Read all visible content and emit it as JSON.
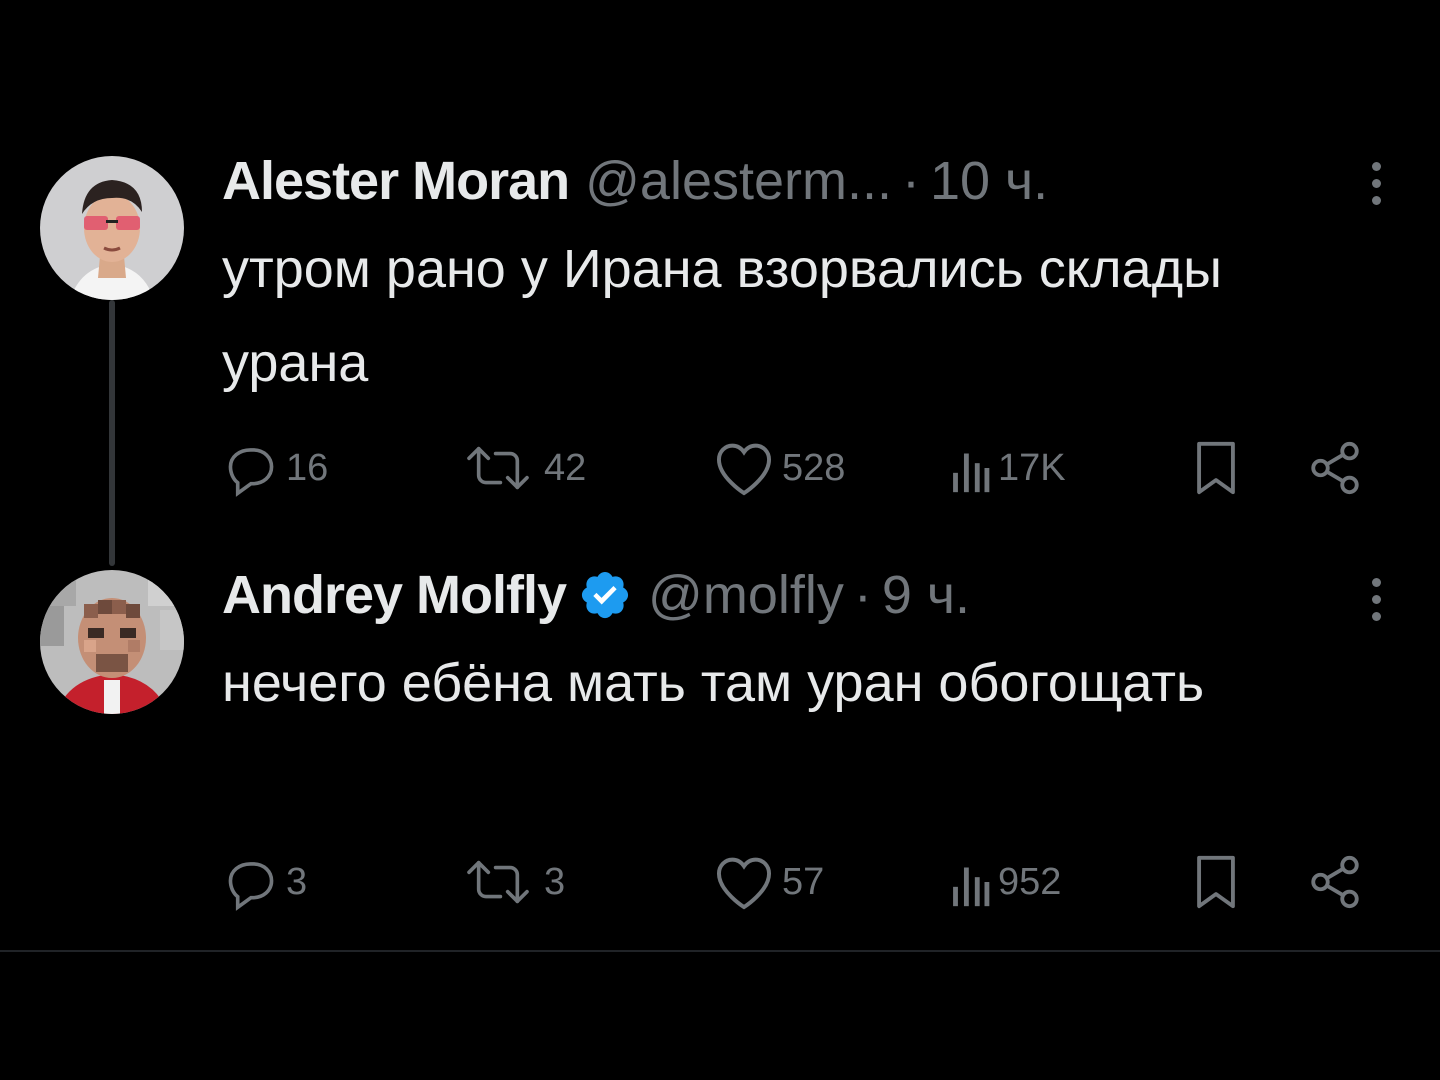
{
  "tweets": [
    {
      "author": "Alester Moran",
      "handle": "@alesterm...",
      "separator": "·",
      "time": "10 ч.",
      "verified": false,
      "text": "утром рано у Ирана взорвались склады урана",
      "stats": {
        "replies": "16",
        "reposts": "42",
        "likes": "528",
        "views": "17K"
      }
    },
    {
      "author": "Andrey Molfly",
      "handle": "@molfly",
      "separator": "·",
      "time": "9 ч.",
      "verified": true,
      "text": "нечего ебёна мать там уран обогощать",
      "stats": {
        "replies": "3",
        "reposts": "3",
        "likes": "57",
        "views": "952"
      }
    }
  ],
  "icons": {
    "reply": "reply-icon",
    "repost": "repost-icon",
    "like": "heart-icon",
    "views": "views-icon",
    "bookmark": "bookmark-icon",
    "share": "share-icon",
    "more": "more-icon",
    "verified": "verified-badge-icon"
  },
  "colors": {
    "background": "#000000",
    "text": "#e7e9ea",
    "muted": "#71767b",
    "verified": "#1d9bf0"
  }
}
